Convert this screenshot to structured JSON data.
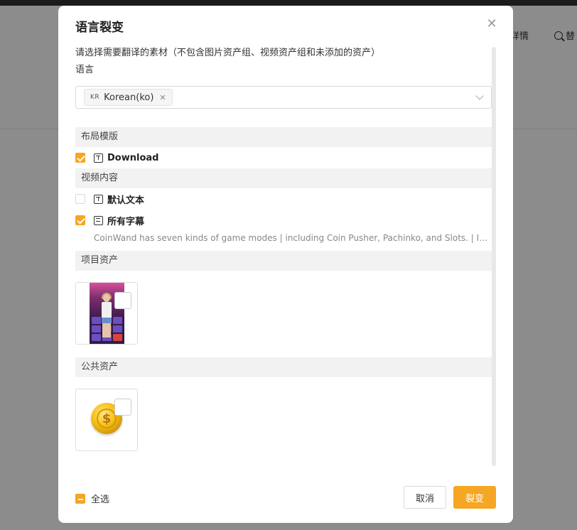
{
  "background": {
    "nav_details": "详情",
    "nav_search_prefix": "替"
  },
  "modal": {
    "title": "语言裂变",
    "close_icon": "close-icon",
    "description": "请选择需要翻译的素材（不包含图片资产组、视频资产组和未添加的资产）",
    "language_label": "语言",
    "language_select": {
      "selected_tag": {
        "flag": "KR",
        "label": "Korean(ko)"
      }
    },
    "sections": {
      "layout_template": {
        "title": "布局模版",
        "items": [
          {
            "label": "Download",
            "checked": true,
            "icon": "text-icon"
          }
        ]
      },
      "video_content": {
        "title": "视频内容",
        "items": [
          {
            "label": "默认文本",
            "checked": false,
            "icon": "text-icon"
          },
          {
            "label": "所有字幕",
            "checked": true,
            "icon": "subtitle-icon",
            "detail": "CoinWand has seven kinds of game modes | including Coin Pusher, Pachinko, and Slots. | In CoinWand..."
          }
        ]
      },
      "project_assets": {
        "title": "项目资产",
        "assets": [
          {
            "thumbnail": "slot-game-video-thumbnail",
            "checked": false
          }
        ]
      },
      "public_assets": {
        "title": "公共资产",
        "assets": [
          {
            "thumbnail": "gold-coin-icon",
            "checked": false
          }
        ]
      }
    },
    "footer": {
      "select_all_label": "全选",
      "select_all_state": "indeterminate",
      "cancel_label": "取消",
      "confirm_label": "裂变"
    }
  },
  "colors": {
    "accent": "#f5a623",
    "mask": "rgba(0,0,0,0.45)"
  }
}
